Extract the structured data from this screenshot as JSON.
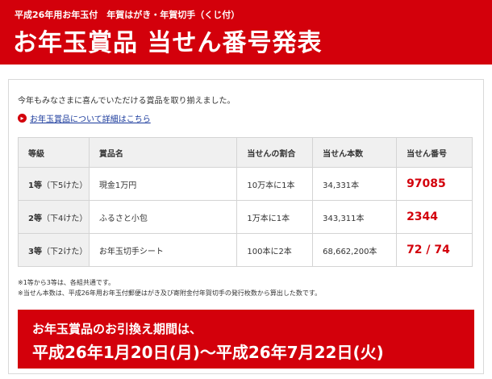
{
  "header": {
    "subtitle": "平成26年用お年玉付　年賀はがき・年賀切手（くじ付）",
    "title": "お年玉賞品 当せん番号発表"
  },
  "intro": "今年もみなさまに喜んでいただける賞品を取り揃えました。",
  "detail_link": "お年玉賞品について詳細はこちら",
  "table": {
    "headers": [
      "等級",
      "賞品名",
      "当せんの割合",
      "当せん本数",
      "当せん番号"
    ],
    "rows": [
      {
        "grade": "1等",
        "digits": "（下5けた）",
        "prize": "現金1万円",
        "ratio": "10万本に1本",
        "count": "34,331本",
        "number": "97085"
      },
      {
        "grade": "2等",
        "digits": "（下4けた）",
        "prize": "ふるさと小包",
        "ratio": "1万本に1本",
        "count": "343,311本",
        "number": "2344"
      },
      {
        "grade": "3等",
        "digits": "（下2けた）",
        "prize": "お年玉切手シート",
        "ratio": "100本に2本",
        "count": "68,662,200本",
        "number": "72 / 74"
      }
    ]
  },
  "notes": [
    "※1等から3等は、各組共通です。",
    "※当せん本数は、平成26年用お年玉付郵便はがき及び寄附金付年賀切手の発行枚数から算出した数です。"
  ],
  "period": {
    "line1": "お年玉賞品のお引換え期間は、",
    "line2": "平成26年1月20日(月)～平成26年7月22日(火)"
  },
  "colors": {
    "accent": "#d3000b",
    "link": "#1a3a9c",
    "header_cell": "#f0f0f0"
  }
}
